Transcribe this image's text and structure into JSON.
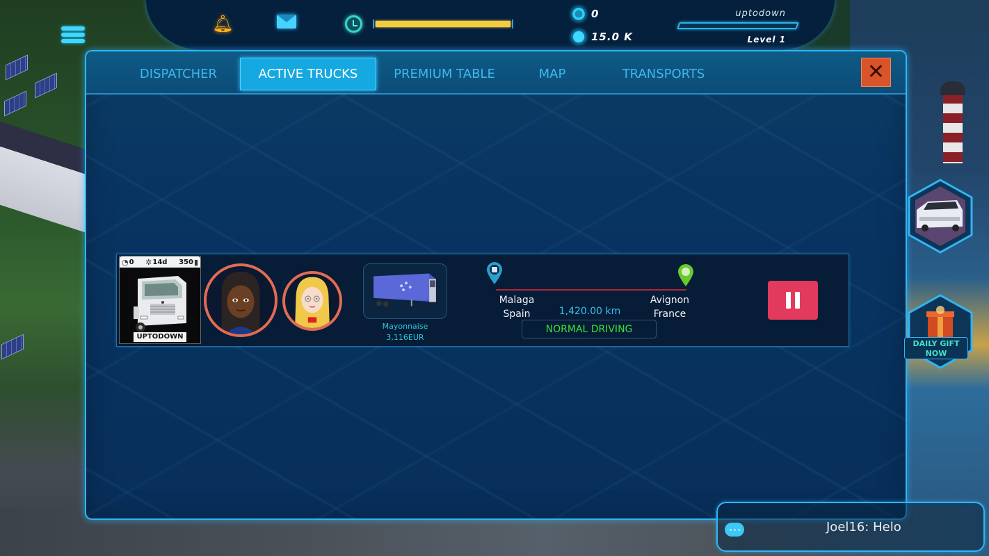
{
  "hud": {
    "icons": [
      "menu-icon",
      "bell-icon",
      "mail-icon",
      "clock-icon"
    ],
    "energy_progress": 1.0,
    "currencies": [
      {
        "icon": "coin-icon",
        "value": "0"
      },
      {
        "icon": "gem-icon",
        "value": "15.0 K"
      }
    ],
    "player_name": "uptodown",
    "xp_progress": 0.0,
    "level_label": "Level 1"
  },
  "dialog": {
    "tabs": [
      {
        "label": "DISPATCHER",
        "active": false
      },
      {
        "label": "ACTIVE TRUCKS",
        "active": true
      },
      {
        "label": "PREMIUM TABLE",
        "active": false
      },
      {
        "label": "MAP",
        "active": false
      },
      {
        "label": "TRANSPORTS",
        "active": false
      }
    ],
    "close_icon": "✕",
    "colors": {
      "accent": "#16a8e0",
      "close": "#d9542a",
      "pause": "#e23a5c",
      "status": "#37e23a"
    }
  },
  "active_truck": {
    "stats": {
      "speed": "0",
      "service": "14d",
      "fuel": "350"
    },
    "truck_name": "UPTODOWN",
    "drivers": [
      "driver-1",
      "driver-2"
    ],
    "cargo": {
      "name": "Mayonnaise",
      "price": "3,116EUR"
    },
    "route": {
      "from_city": "Malaga",
      "from_country": "Spain",
      "to_city": "Avignon",
      "to_country": "France",
      "distance": "1,420.00 km",
      "status": "NORMAL DRIVING",
      "progress": 0.0
    }
  },
  "side_buttons": {
    "van_offer": "van-offer",
    "gift_label_1": "DAILY GIFT",
    "gift_label_2": "NOW"
  },
  "chat": {
    "message": "Joel16: Helo"
  }
}
